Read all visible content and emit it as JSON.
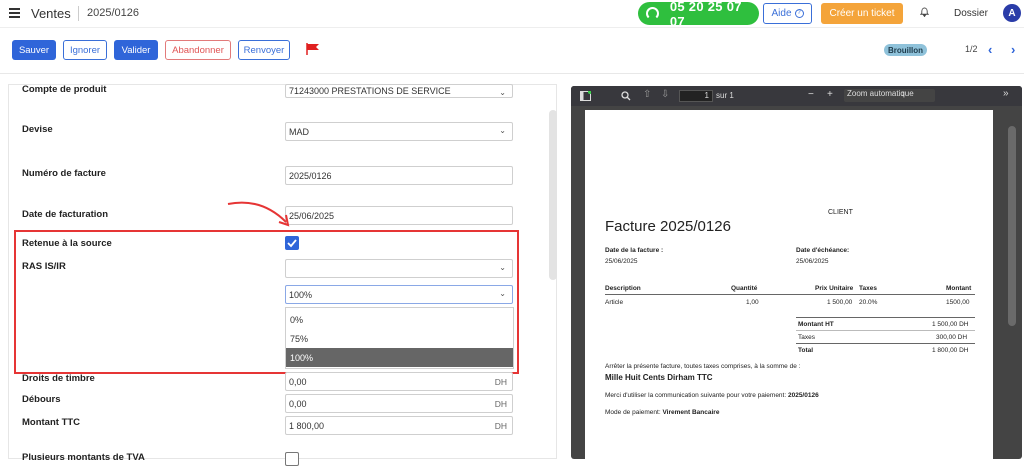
{
  "topbar": {
    "app_title": "Ventes",
    "record_ref": "2025/0126",
    "phone": "05 20 25 07 07",
    "help_label": "Aide",
    "ticket_label": "Créer un ticket",
    "dossier_label": "Dossier",
    "avatar_initial": "A"
  },
  "actions": {
    "save": "Sauver",
    "ignore": "Ignorer",
    "validate": "Valider",
    "abandon": "Abandonner",
    "resend": "Renvoyer",
    "status": "Brouillon",
    "pager": "1/2"
  },
  "form": {
    "product_account_label": "Compte de produit",
    "product_account_value": "71243000 PRESTATIONS DE SERVICE",
    "currency_label": "Devise",
    "currency_value": "MAD",
    "invoice_number_label": "Numéro de facture",
    "invoice_number_value": "2025/0126",
    "invoice_date_label": "Date de facturation",
    "invoice_date_value": "25/06/2025",
    "withholding_label": "Retenue à la source",
    "ras_label": "RAS IS/IR",
    "ras_value": "",
    "ras_rate_value": "100%",
    "rate_options": [
      "0%",
      "75%",
      "100%"
    ],
    "stamp_label": "Droits de timbre",
    "stamp_value": "0,00",
    "disbursements_label": "Débours",
    "disbursements_value": "0,00",
    "total_ttc_label": "Montant TTC",
    "total_ttc_value": "1 800,00",
    "unit": "DH",
    "multi_vat_label": "Plusieurs montants de TVA"
  },
  "pdf": {
    "page_current": "1",
    "page_total": "sur 1",
    "zoom": "Zoom automatique",
    "client": "CLIENT",
    "title": "Facture 2025/0126",
    "invoice_date_label": "Date de la facture :",
    "invoice_date": "25/06/2025",
    "due_date_label": "Date d'échéance:",
    "due_date": "25/06/2025",
    "headers": [
      "Description",
      "Quantité",
      "Prix Unitaire",
      "Taxes",
      "Montant"
    ],
    "row": [
      "Article",
      "1,00",
      "1 500,00",
      "20.0%",
      "1500,00"
    ],
    "ht_label": "Montant HT",
    "ht_value": "1 500,00 DH",
    "tax_label": "Taxes",
    "tax_value": "300,00 DH",
    "total_label": "Total",
    "total_value": "1 800,00 DH",
    "arrete_text": "Arrêter la présente facture, toutes taxes comprises, à la somme de :",
    "amount_words": "Mille Huit Cents Dirham TTC",
    "merci_text": "Merci d'utiliser la communication suivante pour votre paiement:",
    "merci_ref": "2025/0126",
    "payment_label": "Mode de paiement:",
    "payment_value": "Virement Bancaire"
  }
}
